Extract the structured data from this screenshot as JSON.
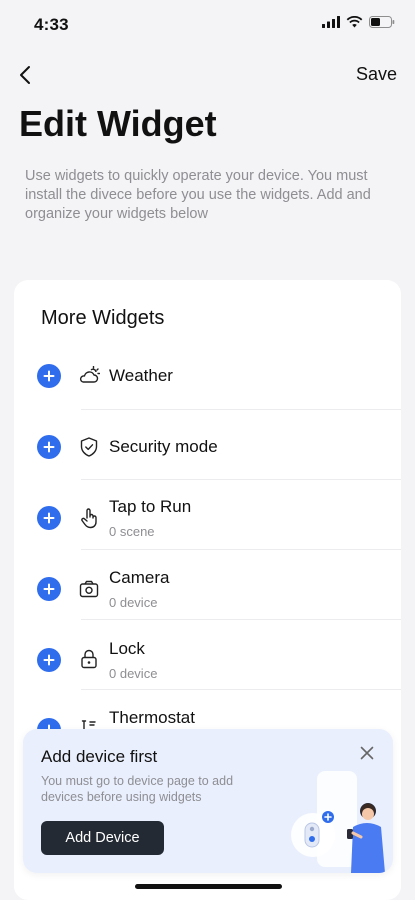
{
  "status_bar": {
    "time": "4:33"
  },
  "nav": {
    "save_label": "Save"
  },
  "page": {
    "title": "Edit Widget",
    "description": "Use widgets to quickly operate your device. You must install the divece before you use the widgets. Add and organize your widgets below"
  },
  "widgets_card": {
    "title": "More Widgets",
    "items": [
      {
        "name": "Weather",
        "sub": "",
        "icon": "weather-icon"
      },
      {
        "name": "Security mode",
        "sub": "",
        "icon": "shield-icon"
      },
      {
        "name": "Tap to Run",
        "sub": "0 scene",
        "icon": "tap-hand-icon"
      },
      {
        "name": "Camera",
        "sub": "0 device",
        "icon": "camera-icon"
      },
      {
        "name": "Lock",
        "sub": "0 device",
        "icon": "lock-icon"
      },
      {
        "name": "Thermostat",
        "sub": "",
        "icon": "thermostat-icon"
      }
    ]
  },
  "banner": {
    "title": "Add device first",
    "text": "You must go to device page to add devices before using widgets",
    "button_label": "Add Device"
  },
  "colors": {
    "accent": "#2f6ded",
    "background": "#f4f4f6",
    "banner_bg": "#e9effd",
    "button_dark": "#232a33"
  }
}
